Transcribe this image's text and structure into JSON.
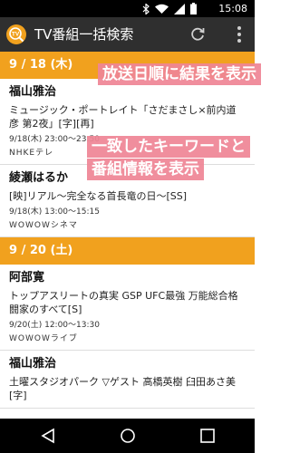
{
  "statusbar": {
    "time": "15:08"
  },
  "appbar": {
    "title": "TV番組一括検索",
    "icon_text": "TV"
  },
  "sections": [
    {
      "date": "9 / 18 (木)",
      "results": [
        {
          "keyword": "福山雅治",
          "title": "ミュージック・ポートレイト「さだまさし×前内道彦 第2夜」[字][再]",
          "time": "9/18(木) 23:00〜23:50",
          "channel": "NHKEテレ"
        },
        {
          "keyword": "綾瀬はるか",
          "title": "[映]リアル〜完全なる首長竜の日〜[SS]",
          "time": "9/18(木) 13:00〜15:15",
          "channel": "WOWOWシネマ"
        }
      ]
    },
    {
      "date": "9 / 20 (土)",
      "results": [
        {
          "keyword": "阿部寛",
          "title": "トップアスリートの真実 GSP UFC最強 万能総合格闘家のすべて[S]",
          "time": "9/20(土) 12:00〜13:30",
          "channel": "WOWOWライブ"
        },
        {
          "keyword": "福山雅治",
          "title": "土曜スタジオパーク ▽ゲスト 高橋英樹 臼田あさ美[字]",
          "time": "",
          "channel": ""
        }
      ]
    }
  ],
  "callouts": [
    "放送日順に結果を表示",
    "一致したキーワードと",
    "番組情報を表示"
  ],
  "colors": {
    "accent": "#f1a11e",
    "callout": "#ef8596",
    "appbar": "#2f2f2f"
  }
}
